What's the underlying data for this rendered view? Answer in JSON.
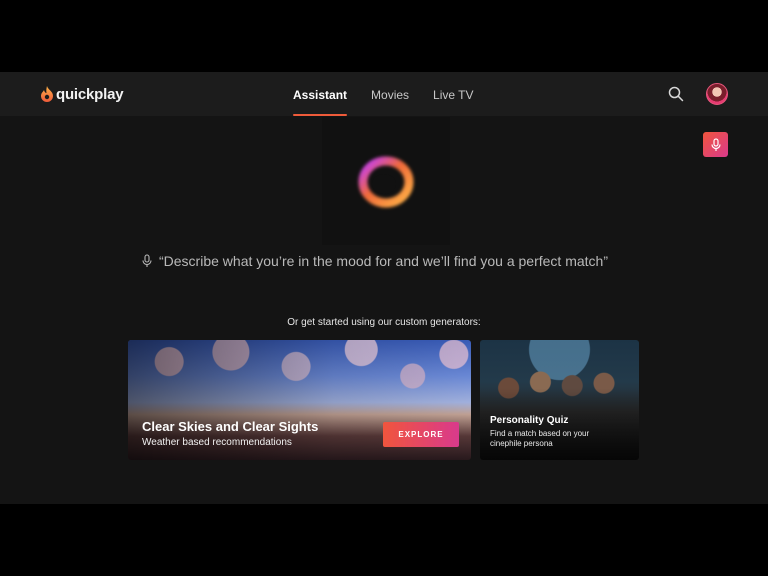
{
  "brand": {
    "name": "quickplay",
    "accent": "#ef5b3a",
    "gradient_start": "#f0553d",
    "gradient_end": "#d93a8c"
  },
  "nav": {
    "tabs": [
      {
        "label": "Assistant",
        "active": true
      },
      {
        "label": "Movies",
        "active": false
      },
      {
        "label": "Live TV",
        "active": false
      }
    ]
  },
  "header_icons": {
    "search": "search-icon",
    "avatar": "user-avatar"
  },
  "assistant": {
    "fab_icon": "microphone-icon",
    "prompt_icon": "microphone-icon",
    "prompt": "“Describe what you’re in the mood for and we’ll find you a perfect match”"
  },
  "generators": {
    "label": "Or get started using our custom generators:",
    "featured": {
      "title": "Clear Skies and Clear Sights",
      "subtitle": "Weather based recommendations",
      "button": "EXPLORE"
    },
    "secondary": {
      "title": "Personality Quiz",
      "description": "Find a match based on your cinephile persona"
    }
  }
}
